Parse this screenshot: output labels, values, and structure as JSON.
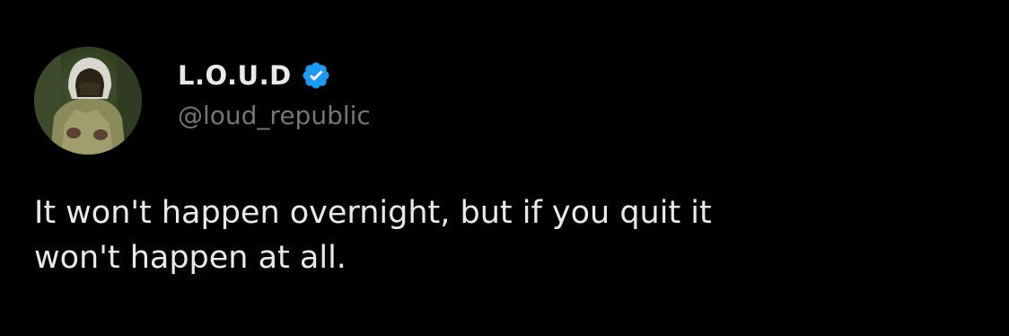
{
  "author": {
    "display_name": "L.O.U.D",
    "handle": "@loud_republic",
    "avatar_icon": "profile-photo",
    "verified_icon": "verified-badge-icon"
  },
  "tweet": {
    "text_lines": [
      "It won't happen overnight, but if you quit it",
      "won't happen at all."
    ]
  },
  "colors": {
    "background": "#000000",
    "primary_text": "#e7e9ea",
    "secondary_text": "#71767b",
    "verified_blue": "#1d9bf0"
  }
}
